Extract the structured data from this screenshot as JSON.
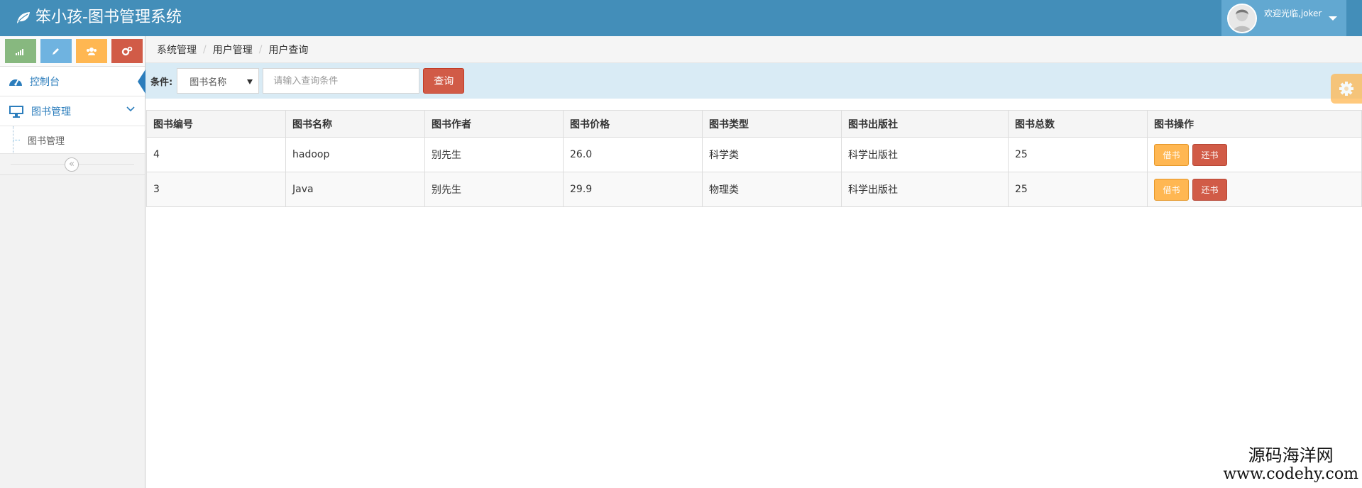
{
  "app": {
    "title": "笨小孩-图书管理系统"
  },
  "user": {
    "welcome": "欢迎光临,joker"
  },
  "sidebar": {
    "shortcuts": [
      {
        "name": "stats-icon",
        "color": "#87b87f"
      },
      {
        "name": "pencil-icon",
        "color": "#6fb3e0"
      },
      {
        "name": "users-icon",
        "color": "#ffb752"
      },
      {
        "name": "cogs-icon",
        "color": "#d15b47"
      }
    ],
    "items": [
      {
        "label": "控制台",
        "icon": "dashboard-icon"
      },
      {
        "label": "图书管理",
        "icon": "desktop-icon"
      }
    ],
    "submenu": [
      {
        "label": "图书管理"
      }
    ]
  },
  "breadcrumb": [
    "系统管理",
    "用户管理",
    "用户查询"
  ],
  "search": {
    "label": "条件:",
    "select_value": "图书名称",
    "placeholder": "请输入查询条件",
    "button": "查询"
  },
  "table": {
    "headers": [
      "图书编号",
      "图书名称",
      "图书作者",
      "图书价格",
      "图书类型",
      "图书出版社",
      "图书总数",
      "图书操作"
    ],
    "rows": [
      [
        "4",
        "hadoop",
        "别先生",
        "26.0",
        "科学类",
        "科学出版社",
        "25"
      ],
      [
        "3",
        "Java",
        "别先生",
        "29.9",
        "物理类",
        "科学出版社",
        "25"
      ]
    ],
    "borrow_label": "借书",
    "return_label": "还书"
  },
  "watermark": {
    "line1": "源码海洋网",
    "line2": "www.codehy.com"
  }
}
